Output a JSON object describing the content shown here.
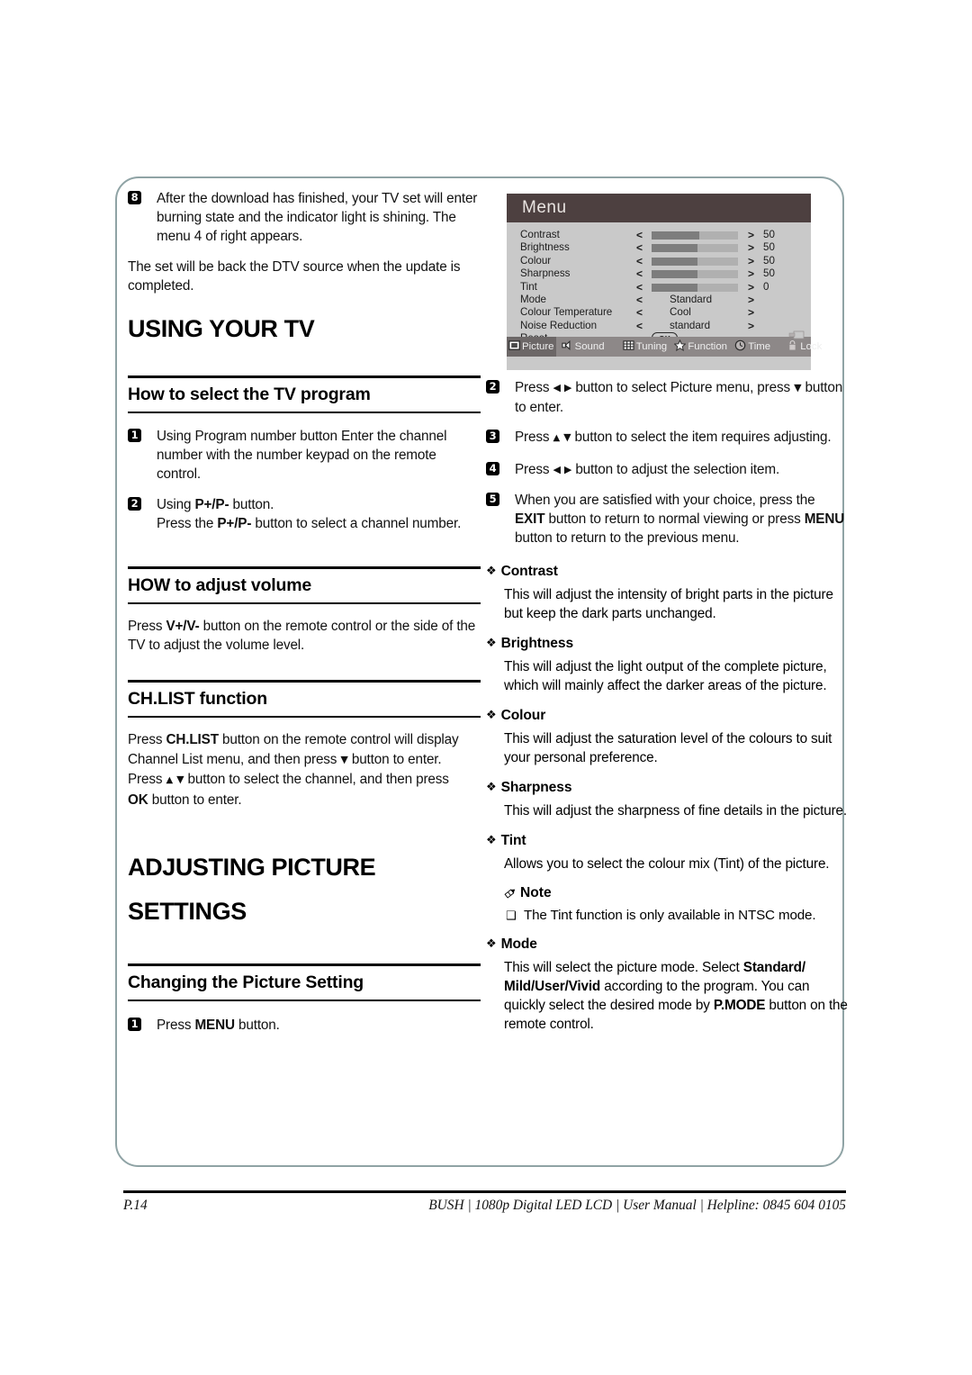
{
  "page": {
    "number": "P.14",
    "footer_meta": "BUSH | 1080p  Digital LED LCD | User Manual | Helpline: 0845 604 0105"
  },
  "left_column": {
    "intro_step": {
      "num": "8",
      "text": "After the download has finished, your TV set will enter burning state and the indicator light is shining. The menu 4 of right appears."
    },
    "intro_note": "The set will be back the DTV source  when the   update is completed.",
    "heading_using_tv": "USING YOUR TV",
    "section_program": {
      "title": "How to select the TV program",
      "steps": [
        {
          "num": "1",
          "text": "Using Program number button Enter the channel number with the number keypad on the remote control."
        },
        {
          "num": "2",
          "line1_pre": "Using ",
          "line1_bold": "P+/P-",
          "line1_post": " button.",
          "line2_pre": "Press the ",
          "line2_bold": "P+/P-",
          "line2_post": " button to select a channel number."
        }
      ]
    },
    "section_volume": {
      "title": "HOW to adjust volume",
      "body_pre": "Press ",
      "body_bold": "V+/V-",
      "body_post": " button on the remote control or the side of the TV to adjust the volume level."
    },
    "section_chlist": {
      "title": "CH.LIST function",
      "p1_pre": "Press ",
      "p1_bold": "CH.LIST",
      "p1_post": " button on the remote control will display Channel List menu, and then press",
      "p1_tail": "button to enter.",
      "p2_pre": "Press",
      "p2_mid": "button to select the channel, and then press",
      "p2_bold": "OK",
      "p2_post": " button to enter."
    },
    "heading_adjusting_1": "ADJUSTING PICTURE",
    "heading_adjusting_2": "SETTINGS",
    "section_changing": {
      "title": "Changing the Picture Setting",
      "step": {
        "num": "1",
        "pre": "Press ",
        "bold": "MENU",
        "post": " button."
      }
    }
  },
  "osd": {
    "title": "Menu",
    "rows": [
      {
        "label": "Contrast",
        "left": "<",
        "right": ">",
        "type": "bar",
        "fill": 55,
        "value": "50"
      },
      {
        "label": "Brightness",
        "left": "<",
        "right": ">",
        "type": "bar",
        "fill": 53,
        "value": "50"
      },
      {
        "label": "Colour",
        "left": "<",
        "right": ">",
        "type": "bar",
        "fill": 53,
        "value": "50"
      },
      {
        "label": "Sharpness",
        "left": "<",
        "right": ">",
        "type": "bar",
        "fill": 53,
        "value": "50"
      },
      {
        "label": "Tint",
        "left": "<",
        "right": ">",
        "type": "bar",
        "fill": 53,
        "value": "0"
      },
      {
        "label": "Mode",
        "left": "<",
        "right": ">",
        "type": "text",
        "option": "Standard"
      },
      {
        "label": "Colour Temperature",
        "left": "<",
        "right": ">",
        "type": "text",
        "option": "Cool"
      },
      {
        "label": "Noise Reduction",
        "left": "<",
        "right": ">",
        "type": "text",
        "option": "standard"
      },
      {
        "label": "Reset",
        "type": "ok",
        "ok_label": "OK"
      }
    ],
    "tabs": [
      {
        "label": "Picture",
        "icon": "picture-icon",
        "active": true
      },
      {
        "label": "Sound",
        "icon": "speaker-icon",
        "active": false
      },
      {
        "label": "Tuning",
        "icon": "grid-icon",
        "active": false
      },
      {
        "label": "Function",
        "icon": "star-icon",
        "active": false
      },
      {
        "label": "Time",
        "icon": "clock-icon",
        "active": false
      },
      {
        "label": "Lock",
        "icon": "padlock-icon",
        "active": false
      }
    ],
    "colors": {
      "title_bar": "#4d4040",
      "body": "#c9c9c9",
      "tab_bar": "#8d8888",
      "tab_active": "#6c6767",
      "bar_fill": "#7d7d7d",
      "bar_track": "#b0b0b0"
    }
  },
  "right_column": {
    "steps": [
      {
        "num": "2",
        "pre": "Press",
        "mid": "button to select Picture menu, press",
        "post": "button to enter."
      },
      {
        "num": "3",
        "pre": "Press",
        "mid": "button to select the item requires adjusting.",
        "post": ""
      },
      {
        "num": "4",
        "pre": "Press",
        "mid": "button to adjust the selection item.",
        "post": ""
      },
      {
        "num": "5",
        "pre": "When you are satisfied with your choice, press the ",
        "bold1": "EXIT",
        "mid": " button to return to normal viewing or press ",
        "bold2": "MENU",
        "post": " button to return to the previous menu."
      }
    ],
    "features": [
      {
        "title": "Contrast",
        "body": "This will adjust the intensity of bright parts in the picture but keep the dark parts unchanged."
      },
      {
        "title": "Brightness",
        "body": "This will adjust the light output of the complete picture, which will mainly affect the darker areas of the picture."
      },
      {
        "title": "Colour",
        "body": "This will adjust the saturation level of the colours to suit your personal preference."
      },
      {
        "title": "Sharpness",
        "body": "This will adjust the sharpness of fine details in the picture."
      },
      {
        "title": "Tint",
        "body": "Allows you to select the colour mix (Tint) of the picture."
      }
    ],
    "note": {
      "heading": "Note",
      "item": "The Tint function is only available in NTSC mode."
    },
    "mode": {
      "title": "Mode",
      "pre": "This will select the picture mode. Select ",
      "bold1": "Standard/ Mild/User/Vivid",
      "mid": " according to the program. You can quickly select the desired mode by ",
      "bold2": "P.MODE",
      "post": " button on the remote control."
    }
  },
  "glyphs": {
    "left_arrow": "◀",
    "right_arrow": "▶",
    "up_arrow": "▲",
    "down_arrow": "▼",
    "diamond_bullet": "❖",
    "square_bullet": "❑"
  }
}
